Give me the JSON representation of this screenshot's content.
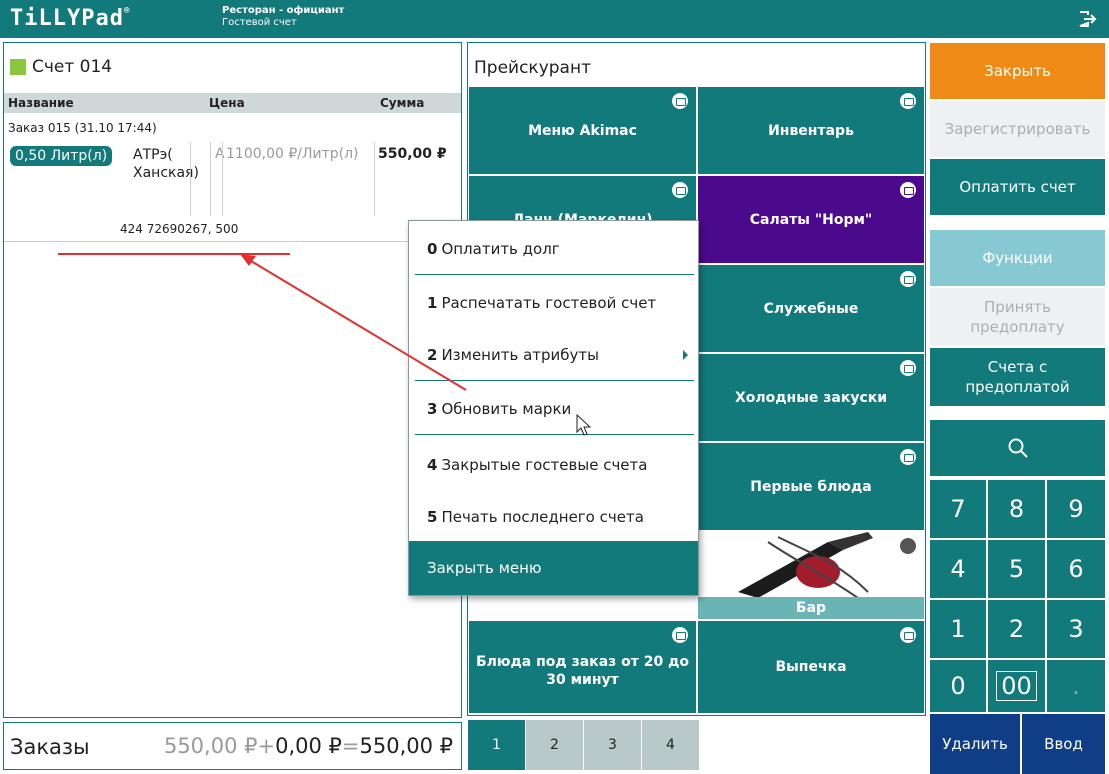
{
  "header": {
    "logo": "TiLLYPad",
    "logo_mark": "®",
    "subtitle_line1": "Ресторан - официант",
    "subtitle_line2": "Гостевой счет"
  },
  "bill": {
    "title": "Счет 014",
    "columns": {
      "name": "Название",
      "price": "Цена",
      "sum": "Сумма"
    },
    "order_line": "Заказ 015 (31.10 17:44)",
    "item": {
      "qty": "0,50 Литр(л)",
      "name": "АТРэ( Ханская)",
      "attr": "A",
      "price": "1100,00 ₽/Литр(л)",
      "sum": "550,00 ₽",
      "mark": "424 72690267, 500"
    }
  },
  "totals": {
    "label": "Заказы",
    "orders": "550,00 ₽",
    "plus": "+",
    "extra": "0,00 ₽",
    "equals": "=",
    "total": "550,00 ₽"
  },
  "pricelist": {
    "title": "Прейскурант",
    "tiles": [
      {
        "label": "Меню Akimac"
      },
      {
        "label": "Инвентарь"
      },
      {
        "label": "Ланч (Маркелин)"
      },
      {
        "label": "Салаты \"Норм\""
      },
      {
        "label": "Служебные"
      },
      {
        "label": "Холодные закуски"
      },
      {
        "label": "Первые блюда"
      },
      {
        "label": "Бар"
      },
      {
        "label": "Блюда под заказ от 20 до 30 минут"
      },
      {
        "label": "Выпечка"
      }
    ],
    "pages": [
      "1",
      "2",
      "3",
      "4"
    ]
  },
  "actions": {
    "close": "Закрыть",
    "register": "Зарегистрировать",
    "pay": "Оплатить счет",
    "functions": "Функции",
    "accept_prepay": "Принять предоплату",
    "prepaid_bills": "Счета с предоплатой",
    "delete": "Удалить",
    "enter": "Ввод"
  },
  "keypad": [
    "7",
    "8",
    "9",
    "4",
    "5",
    "6",
    "1",
    "2",
    "3",
    "0",
    "00",
    "."
  ],
  "menu": {
    "items": [
      {
        "num": "0",
        "label": "Оплатить долг"
      },
      {
        "num": "1",
        "label": "Распечатать гостевой счет"
      },
      {
        "num": "2",
        "label": "Изменить атрибуты"
      },
      {
        "num": "3",
        "label": "Обновить марки"
      },
      {
        "num": "4",
        "label": "Закрытые гостевые счета"
      },
      {
        "num": "5",
        "label": "Печать последнего счета"
      }
    ],
    "close": "Закрыть меню"
  },
  "colors": {
    "teal": "#137a7b",
    "purple": "#4b0a8c",
    "orange": "#ef8a16",
    "navy": "#0f3e86",
    "annotation": "#e03030"
  }
}
